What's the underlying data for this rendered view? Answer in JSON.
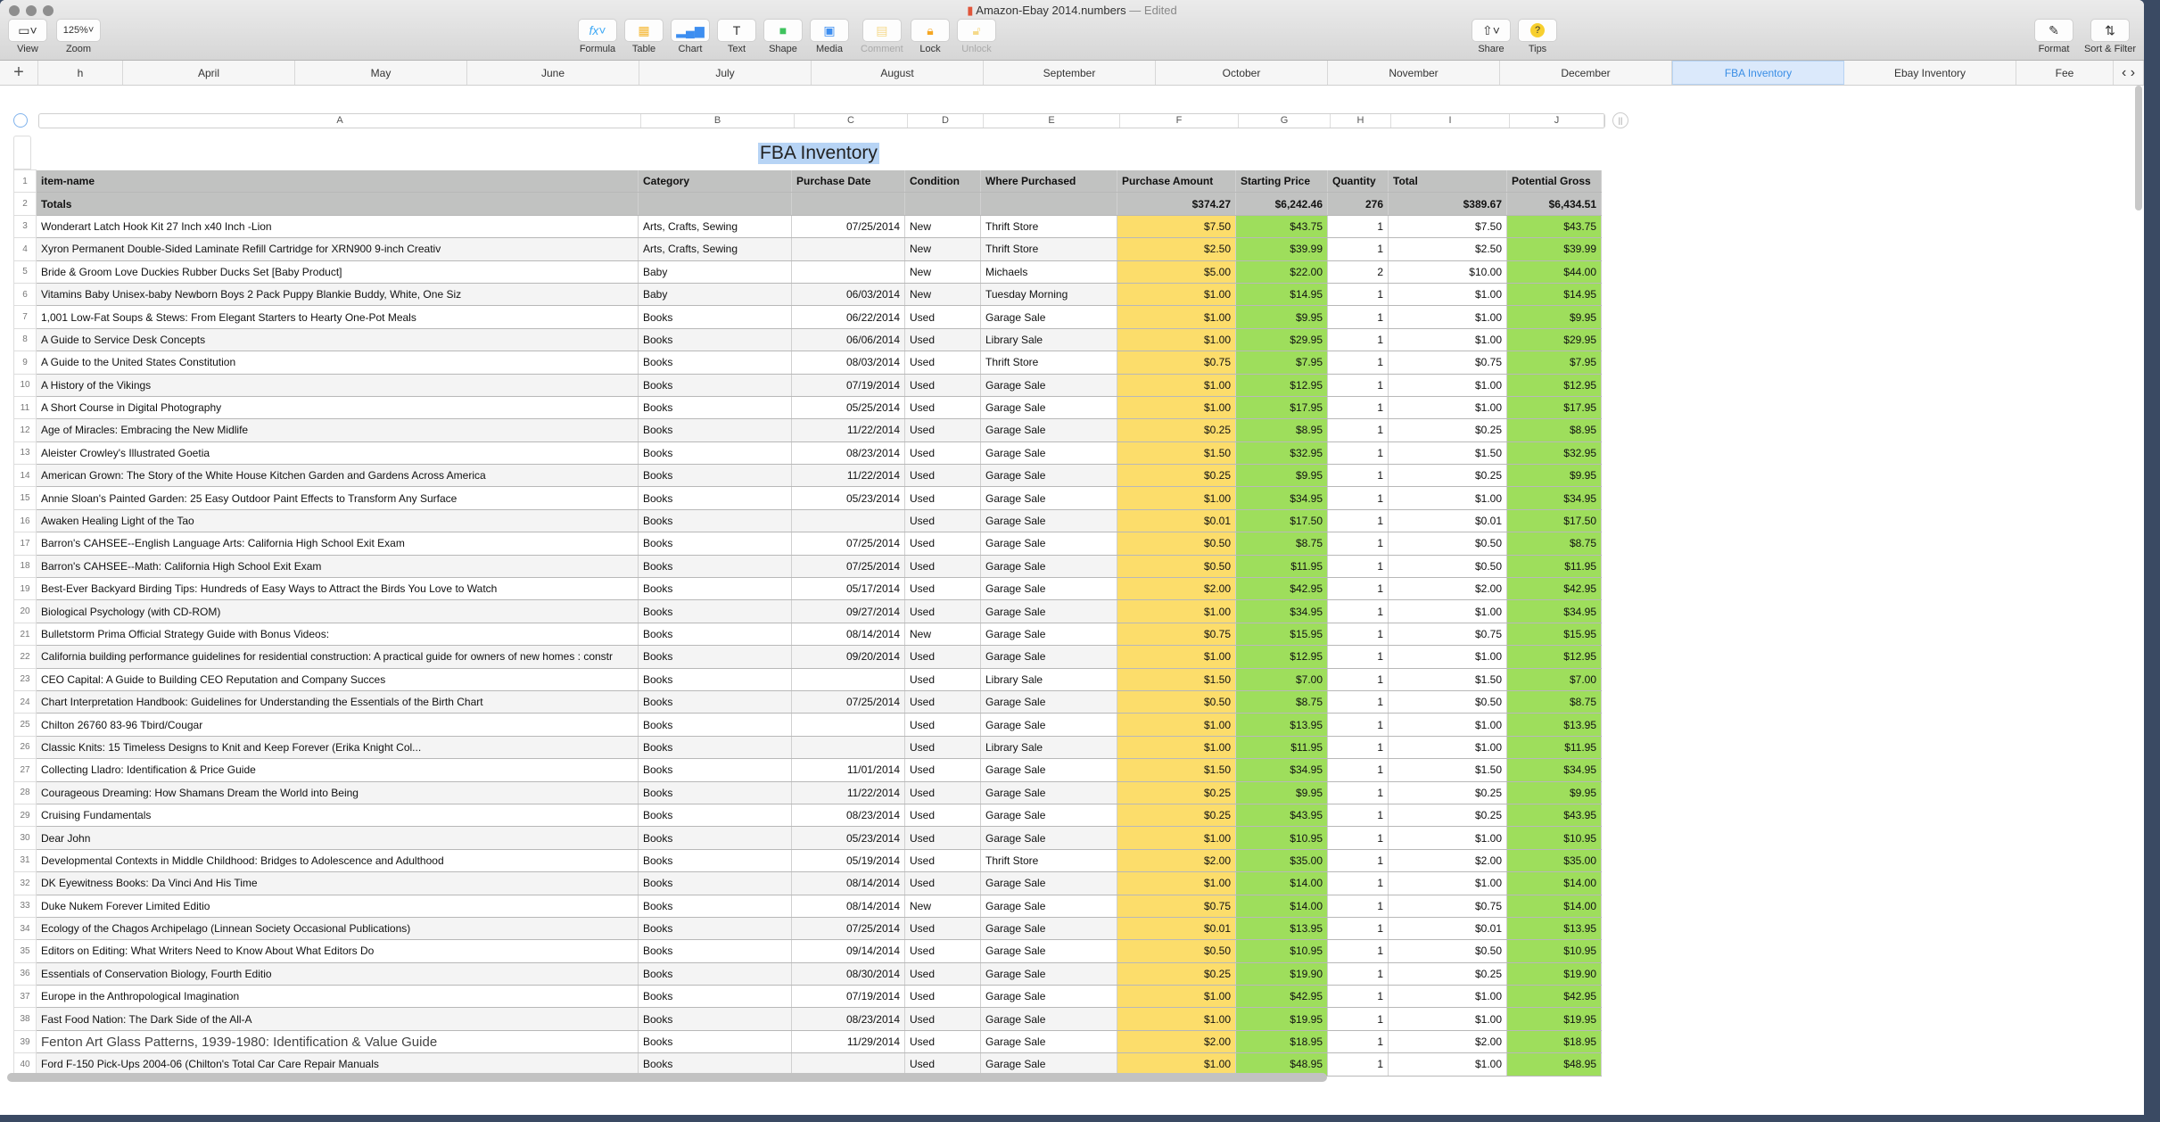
{
  "window": {
    "title": "Amazon-Ebay 2014.numbers",
    "edited": "— Edited"
  },
  "toolbar": {
    "view": "View",
    "zoom": "Zoom",
    "zoom_value": "125%",
    "formula": "Formula",
    "table": "Table",
    "chart": "Chart",
    "text": "Text",
    "shape": "Shape",
    "media": "Media",
    "comment": "Comment",
    "lock": "Lock",
    "unlock": "Unlock",
    "share": "Share",
    "tips": "Tips",
    "format": "Format",
    "sort_filter": "Sort & Filter"
  },
  "tabs": [
    "h",
    "April",
    "May",
    "June",
    "July",
    "August",
    "September",
    "October",
    "November",
    "December",
    "FBA Inventory",
    "Ebay Inventory",
    "Fee"
  ],
  "selected_tab": "FBA Inventory",
  "columns": [
    "A",
    "B",
    "C",
    "D",
    "E",
    "F",
    "G",
    "H",
    "I",
    "J"
  ],
  "sheet": {
    "title": "FBA Inventory"
  },
  "table": {
    "headers": [
      "item-name",
      "Category",
      "Purchase Date",
      "Condition",
      "Where Purchased",
      "Purchase Amount",
      "Starting Price",
      "Quantity",
      "Total",
      "Potential Gross"
    ],
    "totals": [
      "Totals",
      "",
      "",
      "",
      "",
      "$374.27",
      "$6,242.46",
      "276",
      "$389.67",
      "$6,434.51"
    ],
    "rows": [
      [
        "Wonderart Latch Hook Kit 27 Inch x40 Inch -Lion",
        "Arts, Crafts, Sewing",
        "07/25/2014",
        "New",
        "Thrift Store",
        "$7.50",
        "$43.75",
        "1",
        "$7.50",
        "$43.75"
      ],
      [
        "Xyron Permanent Double-Sided Laminate Refill Cartridge for XRN900 9-inch Creativ",
        "Arts, Crafts, Sewing",
        "",
        "New",
        "Thrift Store",
        "$2.50",
        "$39.99",
        "1",
        "$2.50",
        "$39.99"
      ],
      [
        "Bride & Groom Love Duckies Rubber Ducks Set [Baby Product]",
        "Baby",
        "",
        "New",
        "Michaels",
        "$5.00",
        "$22.00",
        "2",
        "$10.00",
        "$44.00"
      ],
      [
        "Vitamins Baby Unisex-baby Newborn Boys 2 Pack Puppy Blankie Buddy, White, One Siz",
        "Baby",
        "06/03/2014",
        "New",
        "Tuesday Morning",
        "$1.00",
        "$14.95",
        "1",
        "$1.00",
        "$14.95"
      ],
      [
        "1,001 Low-Fat Soups & Stews: From Elegant Starters to Hearty One-Pot Meals",
        "Books",
        "06/22/2014",
        "Used",
        "Garage Sale",
        "$1.00",
        "$9.95",
        "1",
        "$1.00",
        "$9.95"
      ],
      [
        "A Guide to Service Desk Concepts",
        "Books",
        "06/06/2014",
        "Used",
        "Library Sale",
        "$1.00",
        "$29.95",
        "1",
        "$1.00",
        "$29.95"
      ],
      [
        "A Guide to the United States Constitution",
        "Books",
        "08/03/2014",
        "Used",
        "Thrift Store",
        "$0.75",
        "$7.95",
        "1",
        "$0.75",
        "$7.95"
      ],
      [
        "A History of the Vikings",
        "Books",
        "07/19/2014",
        "Used",
        "Garage Sale",
        "$1.00",
        "$12.95",
        "1",
        "$1.00",
        "$12.95"
      ],
      [
        "A Short Course in Digital Photography",
        "Books",
        "05/25/2014",
        "Used",
        "Garage Sale",
        "$1.00",
        "$17.95",
        "1",
        "$1.00",
        "$17.95"
      ],
      [
        "Age of Miracles: Embracing the New Midlife",
        "Books",
        "11/22/2014",
        "Used",
        "Garage Sale",
        "$0.25",
        "$8.95",
        "1",
        "$0.25",
        "$8.95"
      ],
      [
        "Aleister Crowley's Illustrated Goetia",
        "Books",
        "08/23/2014",
        "Used",
        "Garage Sale",
        "$1.50",
        "$32.95",
        "1",
        "$1.50",
        "$32.95"
      ],
      [
        "American Grown: The Story of the White House Kitchen Garden and Gardens Across America",
        "Books",
        "11/22/2014",
        "Used",
        "Garage Sale",
        "$0.25",
        "$9.95",
        "1",
        "$0.25",
        "$9.95"
      ],
      [
        "Annie Sloan's Painted Garden: 25 Easy Outdoor Paint Effects to Transform Any Surface",
        "Books",
        "05/23/2014",
        "Used",
        "Garage Sale",
        "$1.00",
        "$34.95",
        "1",
        "$1.00",
        "$34.95"
      ],
      [
        "Awaken Healing Light of the Tao",
        "Books",
        "",
        "Used",
        "Garage Sale",
        "$0.01",
        "$17.50",
        "1",
        "$0.01",
        "$17.50"
      ],
      [
        "Barron's CAHSEE--English Language Arts: California High School Exit Exam",
        "Books",
        "07/25/2014",
        "Used",
        "Garage Sale",
        "$0.50",
        "$8.75",
        "1",
        "$0.50",
        "$8.75"
      ],
      [
        "Barron's CAHSEE--Math: California High School Exit Exam",
        "Books",
        "07/25/2014",
        "Used",
        "Garage Sale",
        "$0.50",
        "$11.95",
        "1",
        "$0.50",
        "$11.95"
      ],
      [
        "Best-Ever Backyard Birding Tips: Hundreds of Easy Ways to Attract the Birds You Love to Watch",
        "Books",
        "05/17/2014",
        "Used",
        "Garage Sale",
        "$2.00",
        "$42.95",
        "1",
        "$2.00",
        "$42.95"
      ],
      [
        "Biological Psychology (with CD-ROM)",
        "Books",
        "09/27/2014",
        "Used",
        "Garage Sale",
        "$1.00",
        "$34.95",
        "1",
        "$1.00",
        "$34.95"
      ],
      [
        "Bulletstorm Prima Official Strategy Guide with Bonus Videos:",
        "Books",
        "08/14/2014",
        "New",
        "Garage Sale",
        "$0.75",
        "$15.95",
        "1",
        "$0.75",
        "$15.95"
      ],
      [
        "California building performance guidelines for residential construction: A practical guide for owners of new homes : constr",
        "Books",
        "09/20/2014",
        "Used",
        "Garage Sale",
        "$1.00",
        "$12.95",
        "1",
        "$1.00",
        "$12.95"
      ],
      [
        "CEO Capital: A Guide to Building CEO Reputation and Company Succes",
        "Books",
        "",
        "Used",
        "Library Sale",
        "$1.50",
        "$7.00",
        "1",
        "$1.50",
        "$7.00"
      ],
      [
        "Chart Interpretation Handbook: Guidelines for Understanding the Essentials of the Birth Chart",
        "Books",
        "07/25/2014",
        "Used",
        "Garage Sale",
        "$0.50",
        "$8.75",
        "1",
        "$0.50",
        "$8.75"
      ],
      [
        "Chilton 26760 83-96 Tbird/Cougar",
        "Books",
        "",
        "Used",
        "Garage Sale",
        "$1.00",
        "$13.95",
        "1",
        "$1.00",
        "$13.95"
      ],
      [
        "Classic Knits: 15 Timeless Designs to Knit and Keep Forever (Erika Knight Col...",
        "Books",
        "",
        "Used",
        "Library Sale",
        "$1.00",
        "$11.95",
        "1",
        "$1.00",
        "$11.95"
      ],
      [
        "Collecting Lladro: Identification & Price Guide",
        "Books",
        "11/01/2014",
        "Used",
        "Garage Sale",
        "$1.50",
        "$34.95",
        "1",
        "$1.50",
        "$34.95"
      ],
      [
        "Courageous Dreaming: How Shamans Dream the World into Being",
        "Books",
        "11/22/2014",
        "Used",
        "Garage Sale",
        "$0.25",
        "$9.95",
        "1",
        "$0.25",
        "$9.95"
      ],
      [
        "Cruising Fundamentals",
        "Books",
        "08/23/2014",
        "Used",
        "Garage Sale",
        "$0.25",
        "$43.95",
        "1",
        "$0.25",
        "$43.95"
      ],
      [
        "Dear John",
        "Books",
        "05/23/2014",
        "Used",
        "Garage Sale",
        "$1.00",
        "$10.95",
        "1",
        "$1.00",
        "$10.95"
      ],
      [
        "Developmental Contexts in Middle Childhood: Bridges to Adolescence and Adulthood",
        "Books",
        "05/19/2014",
        "Used",
        "Thrift Store",
        "$2.00",
        "$35.00",
        "1",
        "$2.00",
        "$35.00"
      ],
      [
        "DK Eyewitness Books: Da Vinci And His Time",
        "Books",
        "08/14/2014",
        "Used",
        "Garage Sale",
        "$1.00",
        "$14.00",
        "1",
        "$1.00",
        "$14.00"
      ],
      [
        "Duke Nukem Forever Limited Editio",
        "Books",
        "08/14/2014",
        "New",
        "Garage Sale",
        "$0.75",
        "$14.00",
        "1",
        "$0.75",
        "$14.00"
      ],
      [
        "Ecology of the Chagos Archipelago (Linnean Society Occasional Publications)",
        "Books",
        "07/25/2014",
        "Used",
        "Garage Sale",
        "$0.01",
        "$13.95",
        "1",
        "$0.01",
        "$13.95"
      ],
      [
        "Editors on Editing: What Writers Need to Know About What Editors Do",
        "Books",
        "09/14/2014",
        "Used",
        "Garage Sale",
        "$0.50",
        "$10.95",
        "1",
        "$0.50",
        "$10.95"
      ],
      [
        "Essentials of Conservation Biology, Fourth Editio",
        "Books",
        "08/30/2014",
        "Used",
        "Garage Sale",
        "$0.25",
        "$19.90",
        "1",
        "$0.25",
        "$19.90"
      ],
      [
        "Europe in the Anthropological Imagination",
        "Books",
        "07/19/2014",
        "Used",
        "Garage Sale",
        "$1.00",
        "$42.95",
        "1",
        "$1.00",
        "$42.95"
      ],
      [
        "Fast Food Nation: The Dark Side of the All-A",
        "Books",
        "08/23/2014",
        "Used",
        "Garage Sale",
        "$1.00",
        "$19.95",
        "1",
        "$1.00",
        "$19.95"
      ],
      [
        "Fenton Art Glass Patterns, 1939-1980: Identification & Value Guide",
        "Books",
        "11/29/2014",
        "Used",
        "Garage Sale",
        "$2.00",
        "$18.95",
        "1",
        "$2.00",
        "$18.95"
      ],
      [
        "Ford F-150 Pick-Ups 2004-06 (Chilton's Total Car Care Repair Manuals",
        "Books",
        "",
        "Used",
        "Garage Sale",
        "$1.00",
        "$48.95",
        "1",
        "$1.00",
        "$48.95"
      ]
    ]
  },
  "colors": {
    "purchase_amount": "#fcdd6b",
    "starting_price": "#9ede5c",
    "potential_gross": "#9ede5c",
    "header": "#c1c2c1",
    "selected_tab": "#3a8ee6"
  }
}
